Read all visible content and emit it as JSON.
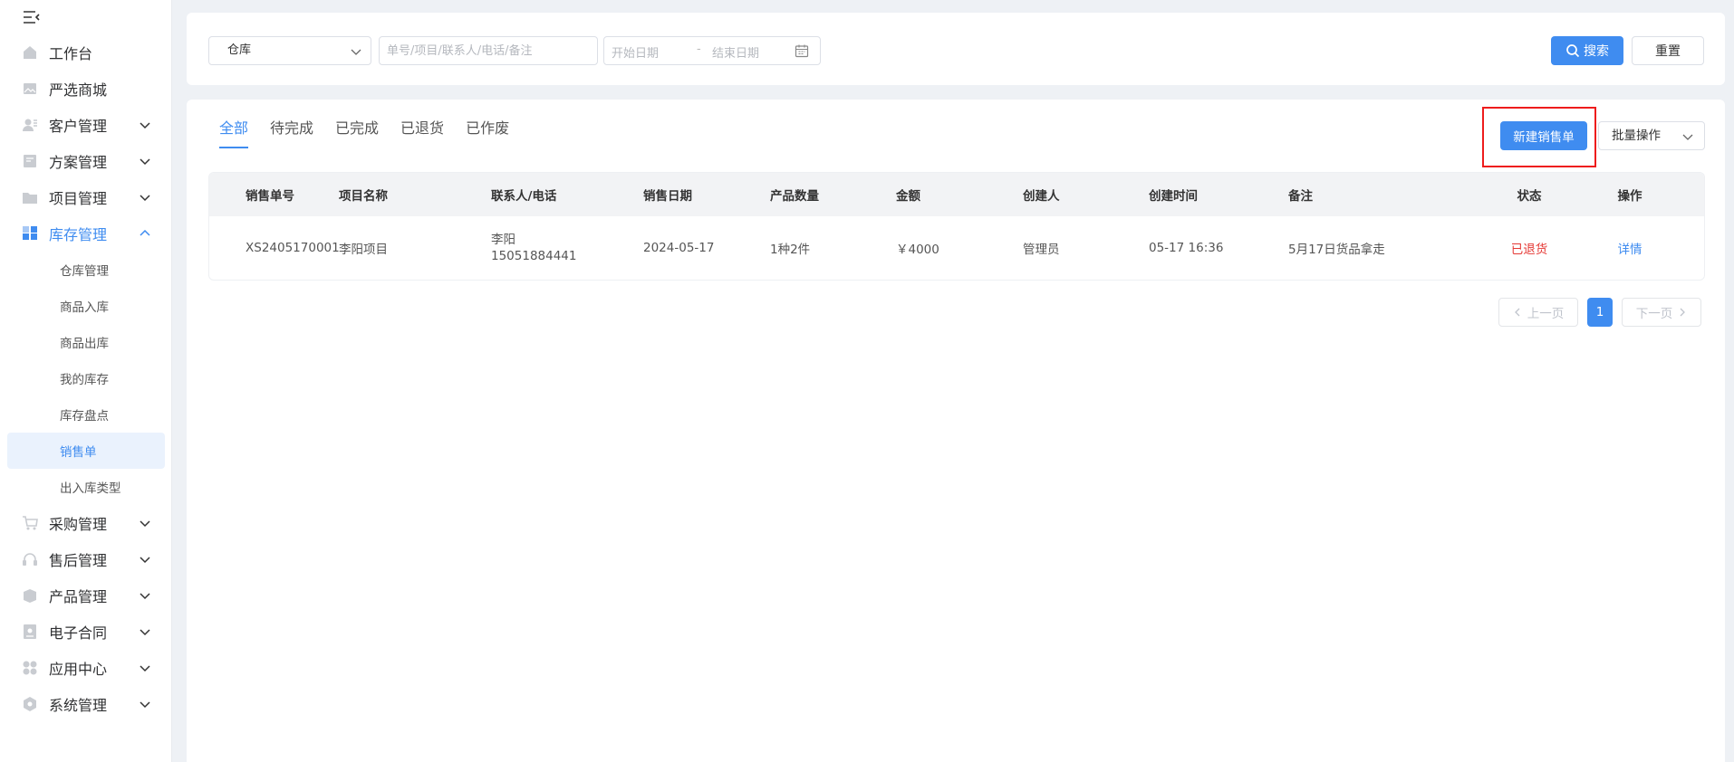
{
  "sidebar": {
    "items": [
      {
        "label": "工作台",
        "icon": "home-icon",
        "expandable": false
      },
      {
        "label": "严选商城",
        "icon": "image-icon",
        "expandable": false
      },
      {
        "label": "客户管理",
        "icon": "customer-icon",
        "expandable": true
      },
      {
        "label": "方案管理",
        "icon": "document-icon",
        "expandable": true
      },
      {
        "label": "项目管理",
        "icon": "folder-icon",
        "expandable": true
      },
      {
        "label": "库存管理",
        "icon": "inventory-icon",
        "expandable": true,
        "expanded": true
      },
      {
        "label": "采购管理",
        "icon": "cart-icon",
        "expandable": true
      },
      {
        "label": "售后管理",
        "icon": "headset-icon",
        "expandable": true
      },
      {
        "label": "产品管理",
        "icon": "box-icon",
        "expandable": true
      },
      {
        "label": "电子合同",
        "icon": "contract-icon",
        "expandable": true
      },
      {
        "label": "应用中心",
        "icon": "apps-icon",
        "expandable": true
      },
      {
        "label": "系统管理",
        "icon": "settings-icon",
        "expandable": true
      }
    ],
    "sub_items": [
      "仓库管理",
      "商品入库",
      "商品出库",
      "我的库存",
      "库存盘点",
      "销售单",
      "出入库类型"
    ],
    "active_sub": "销售单"
  },
  "search": {
    "warehouse_select": "仓库",
    "keyword_placeholder": "单号/项目/联系人/电话/备注",
    "start_date_placeholder": "开始日期",
    "date_separator": "-",
    "end_date_placeholder": "结束日期",
    "search_label": "搜索",
    "reset_label": "重置"
  },
  "tabs": [
    "全部",
    "待完成",
    "已完成",
    "已退货",
    "已作废"
  ],
  "active_tab": "全部",
  "actions": {
    "new_label": "新建销售单",
    "batch_label": "批量操作"
  },
  "table": {
    "headers": [
      "销售单号",
      "项目名称",
      "联系人/电话",
      "销售日期",
      "产品数量",
      "金额",
      "创建人",
      "创建时间",
      "备注",
      "状态",
      "操作"
    ],
    "rows": [
      {
        "order_no": "XS2405170001",
        "project": "李阳项目",
        "contact_name": "李阳",
        "contact_phone": "15051884441",
        "sale_date": "2024-05-17",
        "quantity": "1种2件",
        "amount": "￥4000",
        "creator": "管理员",
        "created_at": "05-17 16:36",
        "remark": "5月17日货品拿走",
        "status": "已退货",
        "action": "详情"
      }
    ]
  },
  "pagination": {
    "prev_label": "上一页",
    "current_page": "1",
    "next_label": "下一页"
  },
  "colors": {
    "accent": "#3f8cf0",
    "status_returned": "#e53935",
    "highlight_box": "#ee1c1c"
  }
}
